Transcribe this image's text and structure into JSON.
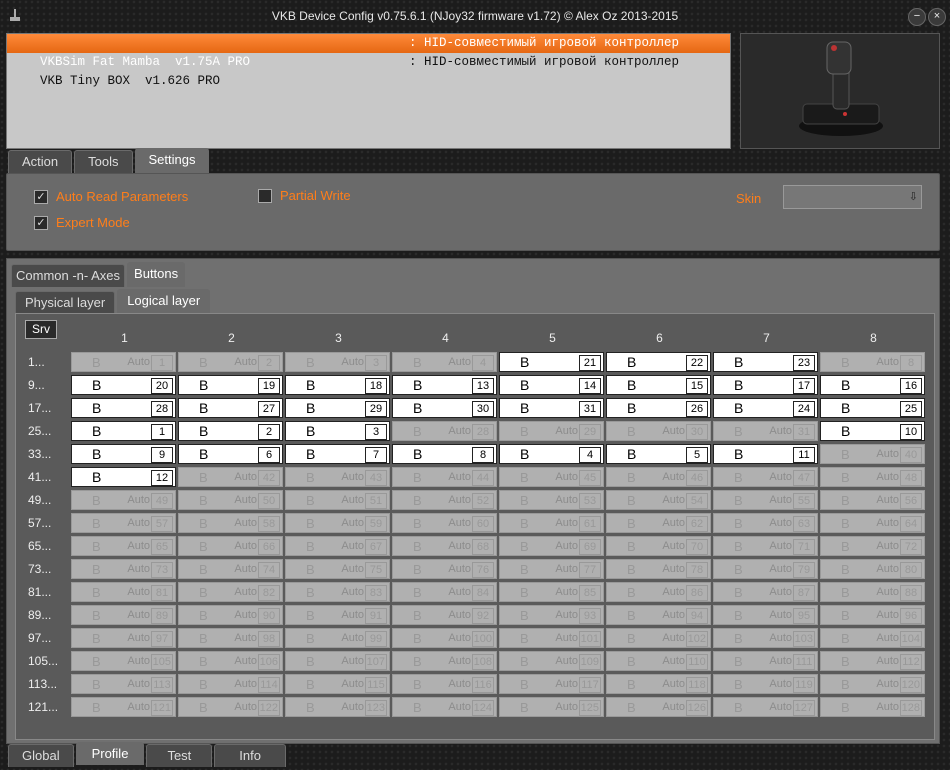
{
  "window": {
    "title": "VKB Device Config v0.75.6.1 (NJoy32 firmware v1.72) © Alex Oz 2013-2015",
    "minimize_label": "−",
    "close_label": "×"
  },
  "devices": [
    {
      "name": "VKBSim Fat Mamba  v1.75A PRO",
      "desc": ": HID-совместимый игровой контроллер",
      "selected": true
    },
    {
      "name": "VKB Tiny BOX  v1.626 PRO",
      "desc": ": HID-совместимый игровой контроллер",
      "selected": false
    }
  ],
  "top_tabs": [
    {
      "label": "Action",
      "active": false
    },
    {
      "label": "Tools",
      "active": false
    },
    {
      "label": "Settings",
      "active": true
    }
  ],
  "settings": {
    "auto_read": {
      "label": "Auto Read Parameters",
      "checked": true
    },
    "expert_mode": {
      "label": "Expert Mode",
      "checked": true
    },
    "partial_write": {
      "label": "Partial Write",
      "checked": false
    },
    "skin_label": "Skin",
    "skin_value": ""
  },
  "section_tabs": [
    {
      "label": "Common -n- Axes",
      "active": false
    },
    {
      "label": "Buttons",
      "active": true
    }
  ],
  "layer_tabs": [
    {
      "label": "Physical layer",
      "active": false
    },
    {
      "label": "Logical layer",
      "active": true
    }
  ],
  "srv_label": "Srv",
  "columns": [
    "1",
    "2",
    "3",
    "4",
    "5",
    "6",
    "7",
    "8"
  ],
  "row_labels": [
    "1...",
    "9...",
    "17...",
    "25...",
    "33...",
    "41...",
    "49...",
    "57...",
    "65...",
    "73...",
    "81...",
    "89...",
    "97...",
    "105...",
    "113...",
    "121..."
  ],
  "cell_letter": "B",
  "auto_label": "Auto",
  "grid": [
    [
      {
        "n": "1",
        "on": false
      },
      {
        "n": "2",
        "on": false
      },
      {
        "n": "3",
        "on": false
      },
      {
        "n": "4",
        "on": false
      },
      {
        "n": "21",
        "on": true
      },
      {
        "n": "22",
        "on": true
      },
      {
        "n": "23",
        "on": true
      },
      {
        "n": "8",
        "on": false
      }
    ],
    [
      {
        "n": "20",
        "on": true
      },
      {
        "n": "19",
        "on": true
      },
      {
        "n": "18",
        "on": true
      },
      {
        "n": "13",
        "on": true
      },
      {
        "n": "14",
        "on": true
      },
      {
        "n": "15",
        "on": true
      },
      {
        "n": "17",
        "on": true
      },
      {
        "n": "16",
        "on": true
      }
    ],
    [
      {
        "n": "28",
        "on": true
      },
      {
        "n": "27",
        "on": true
      },
      {
        "n": "29",
        "on": true
      },
      {
        "n": "30",
        "on": true
      },
      {
        "n": "31",
        "on": true
      },
      {
        "n": "26",
        "on": true
      },
      {
        "n": "24",
        "on": true
      },
      {
        "n": "25",
        "on": true
      }
    ],
    [
      {
        "n": "1",
        "on": true
      },
      {
        "n": "2",
        "on": true
      },
      {
        "n": "3",
        "on": true
      },
      {
        "n": "28",
        "on": false
      },
      {
        "n": "29",
        "on": false
      },
      {
        "n": "30",
        "on": false
      },
      {
        "n": "31",
        "on": false
      },
      {
        "n": "10",
        "on": true
      }
    ],
    [
      {
        "n": "9",
        "on": true
      },
      {
        "n": "6",
        "on": true
      },
      {
        "n": "7",
        "on": true
      },
      {
        "n": "8",
        "on": true
      },
      {
        "n": "4",
        "on": true
      },
      {
        "n": "5",
        "on": true
      },
      {
        "n": "11",
        "on": true
      },
      {
        "n": "40",
        "on": false
      }
    ],
    [
      {
        "n": "12",
        "on": true
      },
      {
        "n": "42",
        "on": false
      },
      {
        "n": "43",
        "on": false
      },
      {
        "n": "44",
        "on": false
      },
      {
        "n": "45",
        "on": false
      },
      {
        "n": "46",
        "on": false
      },
      {
        "n": "47",
        "on": false
      },
      {
        "n": "48",
        "on": false
      }
    ],
    [
      {
        "n": "49",
        "on": false
      },
      {
        "n": "50",
        "on": false
      },
      {
        "n": "51",
        "on": false
      },
      {
        "n": "52",
        "on": false
      },
      {
        "n": "53",
        "on": false
      },
      {
        "n": "54",
        "on": false
      },
      {
        "n": "55",
        "on": false
      },
      {
        "n": "56",
        "on": false
      }
    ],
    [
      {
        "n": "57",
        "on": false
      },
      {
        "n": "58",
        "on": false
      },
      {
        "n": "59",
        "on": false
      },
      {
        "n": "60",
        "on": false
      },
      {
        "n": "61",
        "on": false
      },
      {
        "n": "62",
        "on": false
      },
      {
        "n": "63",
        "on": false
      },
      {
        "n": "64",
        "on": false
      }
    ],
    [
      {
        "n": "65",
        "on": false
      },
      {
        "n": "66",
        "on": false
      },
      {
        "n": "67",
        "on": false
      },
      {
        "n": "68",
        "on": false
      },
      {
        "n": "69",
        "on": false
      },
      {
        "n": "70",
        "on": false
      },
      {
        "n": "71",
        "on": false
      },
      {
        "n": "72",
        "on": false
      }
    ],
    [
      {
        "n": "73",
        "on": false
      },
      {
        "n": "74",
        "on": false
      },
      {
        "n": "75",
        "on": false
      },
      {
        "n": "76",
        "on": false
      },
      {
        "n": "77",
        "on": false
      },
      {
        "n": "78",
        "on": false
      },
      {
        "n": "79",
        "on": false
      },
      {
        "n": "80",
        "on": false
      }
    ],
    [
      {
        "n": "81",
        "on": false
      },
      {
        "n": "82",
        "on": false
      },
      {
        "n": "83",
        "on": false
      },
      {
        "n": "84",
        "on": false
      },
      {
        "n": "85",
        "on": false
      },
      {
        "n": "86",
        "on": false
      },
      {
        "n": "87",
        "on": false
      },
      {
        "n": "88",
        "on": false
      }
    ],
    [
      {
        "n": "89",
        "on": false
      },
      {
        "n": "90",
        "on": false
      },
      {
        "n": "91",
        "on": false
      },
      {
        "n": "92",
        "on": false
      },
      {
        "n": "93",
        "on": false
      },
      {
        "n": "94",
        "on": false
      },
      {
        "n": "95",
        "on": false
      },
      {
        "n": "96",
        "on": false
      }
    ],
    [
      {
        "n": "97",
        "on": false
      },
      {
        "n": "98",
        "on": false
      },
      {
        "n": "99",
        "on": false
      },
      {
        "n": "100",
        "on": false
      },
      {
        "n": "101",
        "on": false
      },
      {
        "n": "102",
        "on": false
      },
      {
        "n": "103",
        "on": false
      },
      {
        "n": "104",
        "on": false
      }
    ],
    [
      {
        "n": "105",
        "on": false
      },
      {
        "n": "106",
        "on": false
      },
      {
        "n": "107",
        "on": false
      },
      {
        "n": "108",
        "on": false
      },
      {
        "n": "109",
        "on": false
      },
      {
        "n": "110",
        "on": false
      },
      {
        "n": "111",
        "on": false
      },
      {
        "n": "112",
        "on": false
      }
    ],
    [
      {
        "n": "113",
        "on": false
      },
      {
        "n": "114",
        "on": false
      },
      {
        "n": "115",
        "on": false
      },
      {
        "n": "116",
        "on": false
      },
      {
        "n": "117",
        "on": false
      },
      {
        "n": "118",
        "on": false
      },
      {
        "n": "119",
        "on": false
      },
      {
        "n": "120",
        "on": false
      }
    ],
    [
      {
        "n": "121",
        "on": false
      },
      {
        "n": "122",
        "on": false
      },
      {
        "n": "123",
        "on": false
      },
      {
        "n": "124",
        "on": false
      },
      {
        "n": "125",
        "on": false
      },
      {
        "n": "126",
        "on": false
      },
      {
        "n": "127",
        "on": false
      },
      {
        "n": "128",
        "on": false
      }
    ]
  ],
  "bottom_tabs": [
    {
      "label": "Global",
      "active": false
    },
    {
      "label": "Profile",
      "active": true
    },
    {
      "label": "Test",
      "active": false
    },
    {
      "label": "Info",
      "active": false
    }
  ],
  "colors": {
    "accent": "#ff7e1a",
    "selection": "#f07020"
  },
  "icons": {
    "app": "joystick-icon",
    "device_preview": "joystick-device-image",
    "dropdown": "dropdown-arrow-icon"
  }
}
